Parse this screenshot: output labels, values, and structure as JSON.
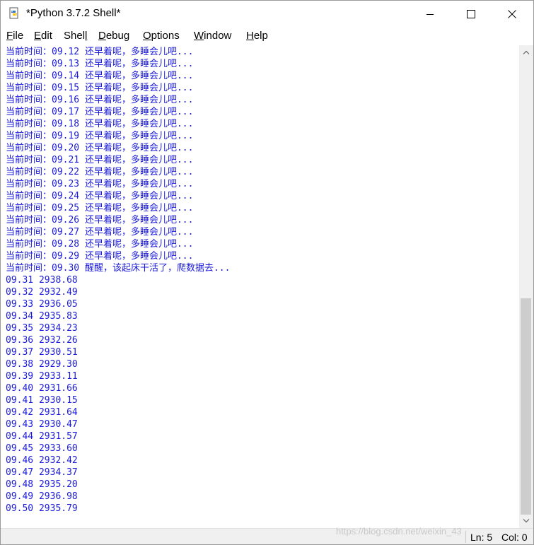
{
  "window": {
    "title": "*Python 3.7.2 Shell*",
    "icon": "python-idle-icon",
    "controls": [
      "minimize-icon",
      "maximize-icon",
      "close-icon"
    ]
  },
  "menu": {
    "items": [
      {
        "label": "File",
        "mnemonic": "F",
        "rest": "ile"
      },
      {
        "label": "Edit",
        "mnemonic": "E",
        "rest": "dit"
      },
      {
        "label": "Shell",
        "mnemonic": "l",
        "pre": "Shel",
        "rest": ""
      },
      {
        "label": "Debug",
        "mnemonic": "D",
        "rest": "ebug"
      },
      {
        "label": "Options",
        "mnemonic": "O",
        "rest": "ptions"
      },
      {
        "label": "Window",
        "mnemonic": "W",
        "rest": "indow"
      },
      {
        "label": "Help",
        "mnemonic": "H",
        "rest": "elp"
      }
    ]
  },
  "shell_output": {
    "lines": [
      "当前时间：09.12 还早着呢，多睡会儿吧...",
      "当前时间：09.13 还早着呢，多睡会儿吧...",
      "当前时间：09.14 还早着呢，多睡会儿吧...",
      "当前时间：09.15 还早着呢，多睡会儿吧...",
      "当前时间：09.16 还早着呢，多睡会儿吧...",
      "当前时间：09.17 还早着呢，多睡会儿吧...",
      "当前时间：09.18 还早着呢，多睡会儿吧...",
      "当前时间：09.19 还早着呢，多睡会儿吧...",
      "当前时间：09.20 还早着呢，多睡会儿吧...",
      "当前时间：09.21 还早着呢，多睡会儿吧...",
      "当前时间：09.22 还早着呢，多睡会儿吧...",
      "当前时间：09.23 还早着呢，多睡会儿吧...",
      "当前时间：09.24 还早着呢，多睡会儿吧...",
      "当前时间：09.25 还早着呢，多睡会儿吧...",
      "当前时间：09.26 还早着呢，多睡会儿吧...",
      "当前时间：09.27 还早着呢，多睡会儿吧...",
      "当前时间：09.28 还早着呢，多睡会儿吧...",
      "当前时间：09.29 还早着呢，多睡会儿吧...",
      "当前时间：09.30 醒醒，该起床干活了，爬数据去...",
      "09.31 2938.68",
      "09.32 2932.49",
      "09.33 2936.05",
      "09.34 2935.83",
      "09.35 2934.23",
      "09.36 2932.26",
      "09.37 2930.51",
      "09.38 2929.30",
      "09.39 2933.11",
      "09.40 2931.66",
      "09.41 2930.15",
      "09.42 2931.64",
      "09.43 2930.47",
      "09.44 2931.57",
      "09.45 2933.60",
      "09.46 2932.42",
      "09.47 2934.37",
      "09.48 2935.20",
      "09.49 2936.98",
      "09.50 2935.79"
    ],
    "text_color": "#1a1ad8"
  },
  "status": {
    "line": "Ln: 5",
    "col": "Col: 0"
  },
  "watermark": "https://blog.csdn.net/weixin_43"
}
